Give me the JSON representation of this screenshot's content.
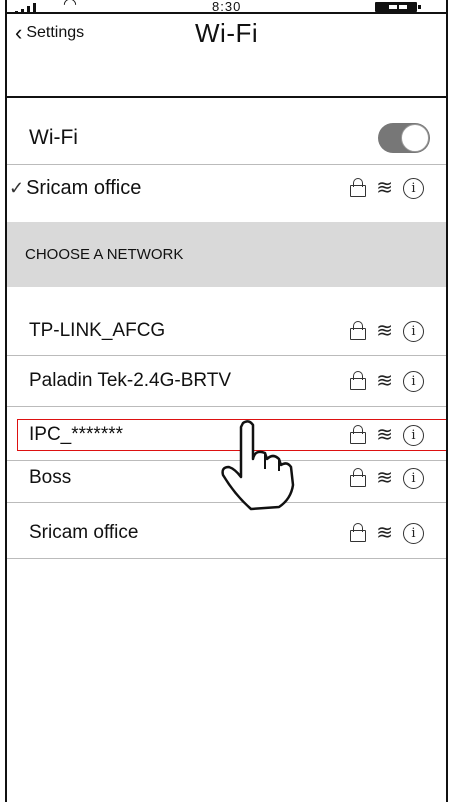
{
  "status_bar": {
    "time": "8:30",
    "signal_icon": "signal-icon",
    "wifi_icon": "wifi-icon",
    "battery_icon": "battery-icon"
  },
  "nav": {
    "back_label": "Settings",
    "title": "Wi-Fi"
  },
  "wifi_toggle": {
    "label": "Wi-Fi",
    "state": "on"
  },
  "connected": {
    "name": "Sricam office",
    "check_icon": "checkmark-icon"
  },
  "section": {
    "header": "CHOOSE A NETWORK"
  },
  "networks": [
    {
      "name": "TP-LINK_AFCG"
    },
    {
      "name": "Paladin Tek-2.4G-BRTV"
    },
    {
      "name": "IPC_*******",
      "highlighted": true
    },
    {
      "name": "Boss"
    },
    {
      "name": "Sricam office"
    }
  ],
  "colors": {
    "highlight": "#dd1111",
    "section_bg": "#d9d9d9",
    "toggle_on": "#777777"
  }
}
